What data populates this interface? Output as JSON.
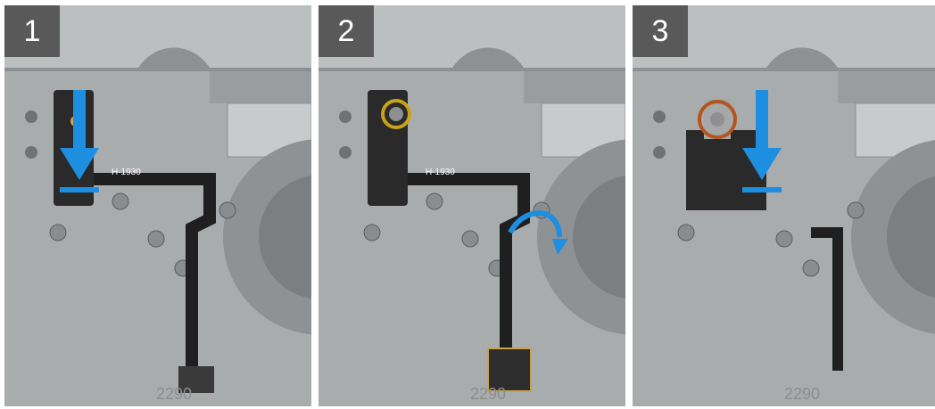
{
  "steps": [
    {
      "number": "1",
      "cable_label": "H-1930",
      "footer_code": "2290"
    },
    {
      "number": "2",
      "cable_label": "H-1930",
      "footer_code": "2290"
    },
    {
      "number": "3",
      "footer_code": "2290"
    }
  ],
  "colors": {
    "badge": "#595959",
    "arrow": "#1e8fe0",
    "screw_highlight_step2": "#c9a21a",
    "screw_highlight_step3": "#b5541e",
    "chassis": "#a9acad"
  },
  "icons": [
    "down-arrow-icon",
    "rotate-arrow-icon",
    "screw-highlight-circle"
  ]
}
